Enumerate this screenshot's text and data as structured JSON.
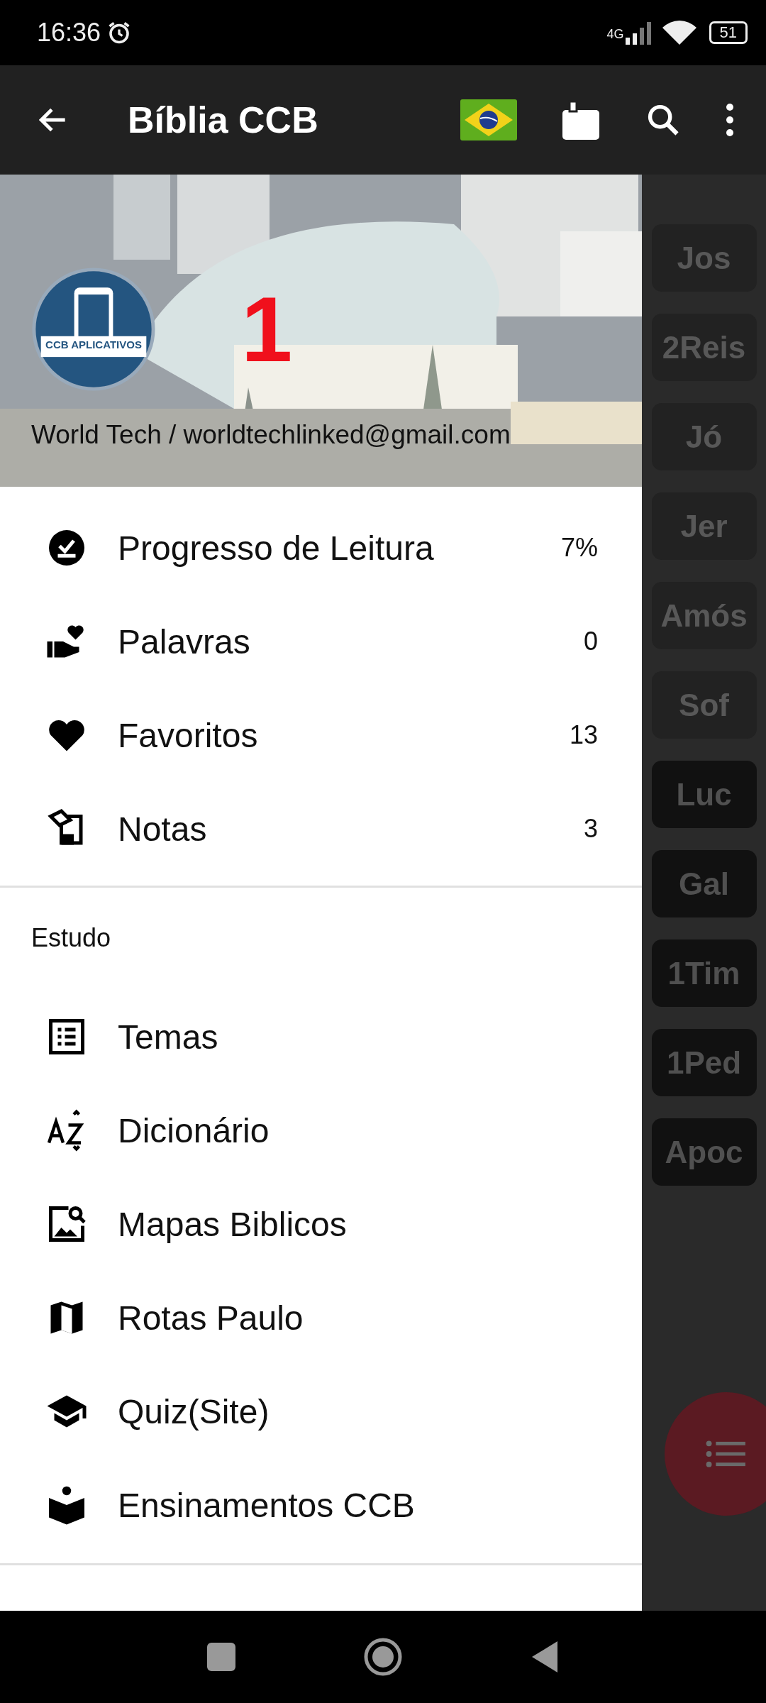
{
  "status_bar": {
    "time": "16:36",
    "network": "4G",
    "battery": "51"
  },
  "toolbar": {
    "title": "Bíblia CCB"
  },
  "books": [
    {
      "label": "Jos",
      "kind": "old"
    },
    {
      "label": "2Reis",
      "kind": "old"
    },
    {
      "label": "Jó",
      "kind": "old"
    },
    {
      "label": "Jer",
      "kind": "old"
    },
    {
      "label": "Amós",
      "kind": "old"
    },
    {
      "label": "Sof",
      "kind": "old"
    },
    {
      "label": "Luc",
      "kind": "new"
    },
    {
      "label": "Gal",
      "kind": "new"
    },
    {
      "label": "1Tim",
      "kind": "new"
    },
    {
      "label": "1Ped",
      "kind": "new"
    },
    {
      "label": "Apoc",
      "kind": "new"
    }
  ],
  "drawer": {
    "header": {
      "logo_text": "CCB APLICATIVOS",
      "badge": "1",
      "account": "World Tech / worldtechlinked@gmail.com"
    },
    "items": [
      {
        "label": "Progresso de Leitura",
        "count": "7%"
      },
      {
        "label": "Palavras",
        "count": "0"
      },
      {
        "label": "Favoritos",
        "count": "13"
      },
      {
        "label": "Notas",
        "count": "3"
      }
    ],
    "sections": [
      {
        "title": "Estudo",
        "items": [
          {
            "label": "Temas"
          },
          {
            "label": "Dicionário"
          },
          {
            "label": "Mapas Biblicos"
          },
          {
            "label": "Rotas Paulo"
          },
          {
            "label": "Quiz(Site)"
          },
          {
            "label": "Ensinamentos CCB"
          }
        ]
      }
    ]
  }
}
